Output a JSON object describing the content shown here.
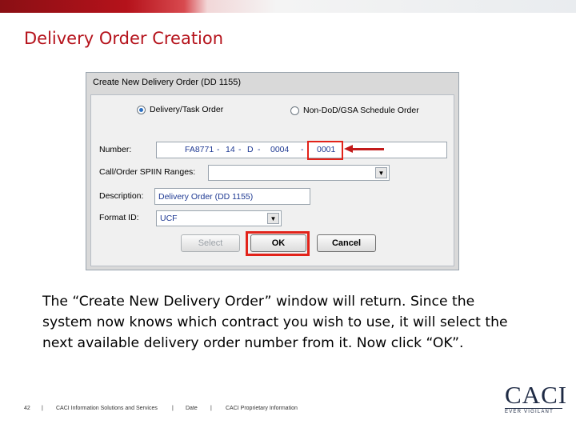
{
  "slide": {
    "title": "Delivery Order Creation",
    "body": "The “Create New Delivery Order” window will return. Since the system now knows which contract you wish to use, it will select the next available delivery order number from it.  Now click “OK”."
  },
  "dialog": {
    "title": "Create New Delivery Order (DD 1155)",
    "radio_options": [
      {
        "label": "Delivery/Task Order",
        "selected": true
      },
      {
        "label": "Non-DoD/GSA Schedule Order",
        "selected": false
      }
    ],
    "number": {
      "label": "Number:",
      "segments": [
        "FA8771",
        "14",
        "D",
        "0004"
      ],
      "separator": "-",
      "order_number": "0001"
    },
    "call_order": {
      "label": "Call/Order SPIIN Ranges:",
      "value": ""
    },
    "description": {
      "label": "Description:",
      "value": "Delivery Order (DD 1155)"
    },
    "format": {
      "label": "Format ID:",
      "value": "UCF"
    },
    "buttons": {
      "select": "Select",
      "ok": "OK",
      "cancel": "Cancel"
    }
  },
  "footer": {
    "page": "42",
    "sep": "|",
    "company": "CACI Information Solutions and Services",
    "date": "Date",
    "proprietary": "CACI Proprietary Information"
  },
  "logo": {
    "name": "CACI",
    "tagline": "EVER VIGILANT"
  },
  "colors": {
    "accent": "#b5121b",
    "highlight": "#e2231a",
    "field_text": "#1f3a93"
  },
  "icons": {
    "combo": "chevron-down-icon",
    "pointer": "arrow-left-icon"
  }
}
